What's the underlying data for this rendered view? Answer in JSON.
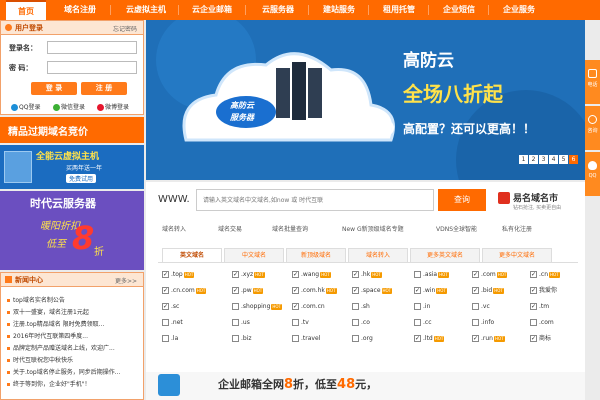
{
  "nav": {
    "items": [
      "首页",
      "域名注册",
      "云虚拟主机",
      "云企业邮箱",
      "云服务器",
      "建站服务",
      "租用托管",
      "企业短信",
      "企业服务"
    ],
    "active": "首页"
  },
  "login": {
    "title": "用户登录",
    "forgot": "忘记密码",
    "account_label": "登录名：",
    "password_label": "密 码：",
    "login_btn": "登 录",
    "register_btn": "注 册",
    "qq": "QQ登录",
    "wechat": "微信登录",
    "weibo": "微博登录"
  },
  "side_banners": {
    "expired": "精品过期域名竞价",
    "host_title": "全能云虚拟主机",
    "host_sub": "买两年送一年",
    "host_btn": "免费试用",
    "server_title": "时代云服务器",
    "server_promo": "暖阳折扣",
    "server_price_pre": "低至",
    "server_num": "8",
    "server_unit": "折"
  },
  "news": {
    "title": "新闻中心",
    "more": "更多>>",
    "items": [
      "top域名实名制公告",
      "双十一盛宴，域名注册1元起",
      "注册.top精品域名 限时免费领取...",
      "2016年时代互联第四季度...",
      "品牌定制产品赠送域名上线，欢迎广...",
      "时代互联祝您中秋快乐",
      "关于.top域名停止服务，同步后期操作...",
      "终于等到你，企业好\"手机\"！"
    ]
  },
  "hero": {
    "title": "高防云",
    "promo": "全场八折起",
    "slogan": "高配置？还可以更高！！",
    "badge_line1": "高防云",
    "badge_line2": "服务器",
    "pages": [
      "1",
      "2",
      "3",
      "4",
      "5",
      "6"
    ]
  },
  "search": {
    "www": "WWW.",
    "placeholder": "请输入英文域名中文域名,如now 或 时代互联",
    "button": "查询",
    "brand": "易名域名市",
    "brand_sub": "钻石抢注, 买卖更自由",
    "links": [
      "域名转入",
      "域名交易",
      "域名批量查询",
      "New G新顶级域名专题",
      "VDNS全球智能",
      "私有化注册"
    ]
  },
  "tld": {
    "tabs": [
      "英文域名",
      "中文域名",
      "新顶级域名",
      "域名转入",
      "更多英文域名",
      "更多中文域名"
    ],
    "active_tab": "英文域名",
    "rows": [
      [
        {
          "name": ".top",
          "on": true,
          "hot": true
        },
        {
          "name": ".xyz",
          "on": true,
          "hot": true
        },
        {
          "name": ".wang",
          "on": true,
          "hot": true
        },
        {
          "name": ".hk",
          "on": true,
          "hot": true
        },
        {
          "name": ".asia",
          "on": false,
          "hot": true
        },
        {
          "name": ".com",
          "on": true,
          "hot": true
        },
        {
          "name": ".cn",
          "on": true,
          "hot": true
        }
      ],
      [
        {
          "name": ".cn.com",
          "on": true,
          "hot": true
        },
        {
          "name": ".pw",
          "on": true,
          "hot": true
        },
        {
          "name": ".com.hk",
          "on": true,
          "hot": true
        },
        {
          "name": ".space",
          "on": true,
          "hot": true
        },
        {
          "name": ".win",
          "on": true,
          "hot": true
        },
        {
          "name": ".bid",
          "on": true,
          "hot": true
        },
        {
          "name": "我爱你",
          "on": true,
          "hot": false
        }
      ],
      [
        {
          "name": ".sc",
          "on": true,
          "hot": false
        },
        {
          "name": ".shopping",
          "on": false,
          "hot": true
        },
        {
          "name": ".com.cn",
          "on": true,
          "hot": false
        },
        {
          "name": ".sh",
          "on": false,
          "hot": false
        },
        {
          "name": ".in",
          "on": false,
          "hot": false
        },
        {
          "name": ".vc",
          "on": false,
          "hot": false
        },
        {
          "name": ".tm",
          "on": true,
          "hot": false
        }
      ],
      [
        {
          "name": ".net",
          "on": false,
          "hot": false
        },
        {
          "name": ".us",
          "on": false,
          "hot": false
        },
        {
          "name": ".tv",
          "on": false,
          "hot": false
        },
        {
          "name": ".co",
          "on": false,
          "hot": false
        },
        {
          "name": ".cc",
          "on": false,
          "hot": false
        },
        {
          "name": ".info",
          "on": false,
          "hot": false
        },
        {
          "name": ".com",
          "on": false,
          "hot": false
        }
      ],
      [
        {
          "name": ".la",
          "on": false,
          "hot": false
        },
        {
          "name": ".biz",
          "on": false,
          "hot": false
        },
        {
          "name": ".travel",
          "on": false,
          "hot": false
        },
        {
          "name": ".org",
          "on": false,
          "hot": false
        },
        {
          "name": ".ltd",
          "on": true,
          "hot": true
        },
        {
          "name": ".run",
          "on": true,
          "hot": true
        },
        {
          "name": "商标",
          "on": true,
          "hot": false
        }
      ]
    ],
    "hot_label": "HOT"
  },
  "bottom_banner": {
    "text_pre": "企业邮箱全网",
    "num1": "8",
    "text_mid": "折，低至",
    "num2": "48",
    "text_post": "元，"
  },
  "right_bar": {
    "phone": "电话",
    "consult": "咨询",
    "qq": "QQ"
  },
  "colors": {
    "brand_orange": "#ff6a00",
    "hero_blue": "#1f6fb8",
    "hero_yellow": "#ffe24a"
  }
}
